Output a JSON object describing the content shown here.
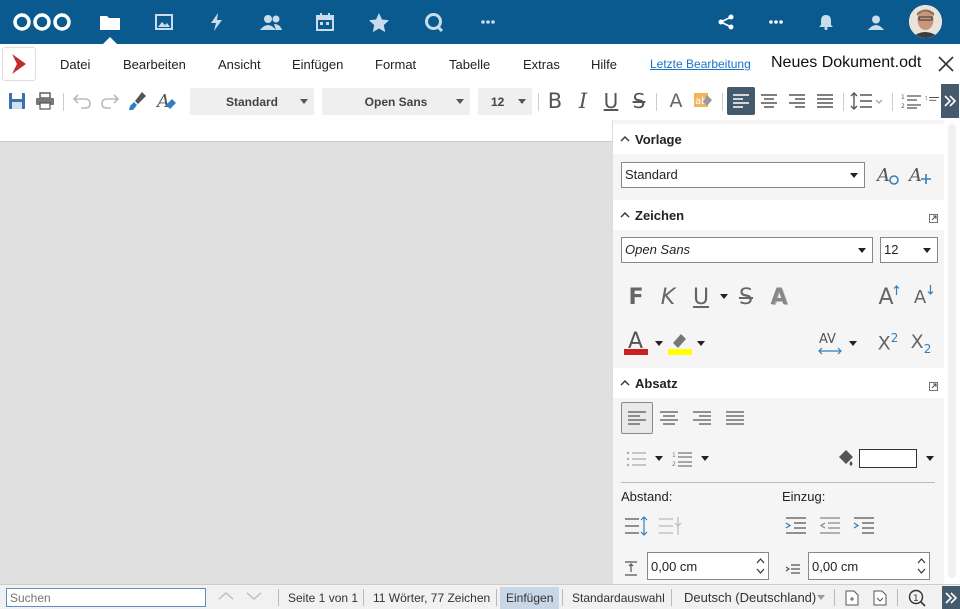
{
  "nextcloud": {
    "apps": [
      "files",
      "photos",
      "activity",
      "contacts",
      "calendar",
      "favorites",
      "talk",
      "more"
    ],
    "active_app": "files"
  },
  "menu": {
    "items": [
      "Datei",
      "Bearbeiten",
      "Ansicht",
      "Einfügen",
      "Format",
      "Tabelle",
      "Extras",
      "Hilfe"
    ],
    "last_edit": "Letzte Bearbeitung",
    "doc_title": "Neues Dokument.odt"
  },
  "toolbar": {
    "paragraph_style": "Standard",
    "font_name": "Open Sans",
    "font_size": "12"
  },
  "sidebar": {
    "vorlage": {
      "title": "Vorlage",
      "style_value": "Standard"
    },
    "zeichen": {
      "title": "Zeichen",
      "font_value": "Open Sans",
      "size_value": "12",
      "bold": "F",
      "italic": "K",
      "underline": "U",
      "strike": "S",
      "shadow": "A",
      "grow": "A",
      "shrink": "A",
      "font_color_letter": "A",
      "spacing_label": "AV",
      "superscript": "X",
      "superscript_exp": "2",
      "subscript": "X",
      "subscript_exp": "2"
    },
    "absatz": {
      "title": "Absatz",
      "abstand_label": "Abstand:",
      "einzug_label": "Einzug:",
      "abstand_value": "0,00 cm",
      "einzug_value": "0,00 cm"
    }
  },
  "statusbar": {
    "search_placeholder": "Suchen",
    "page": "Seite 1 von 1",
    "words": "11 Wörter, 77 Zeichen",
    "insert_mode": "Einfügen",
    "selection_mode": "Standardauswahl",
    "language": "Deutsch (Deutschland)"
  },
  "colors": {
    "header_bg": "#0a5a8f",
    "font_color": "#c9211e",
    "highlight_color": "#ffff00"
  }
}
